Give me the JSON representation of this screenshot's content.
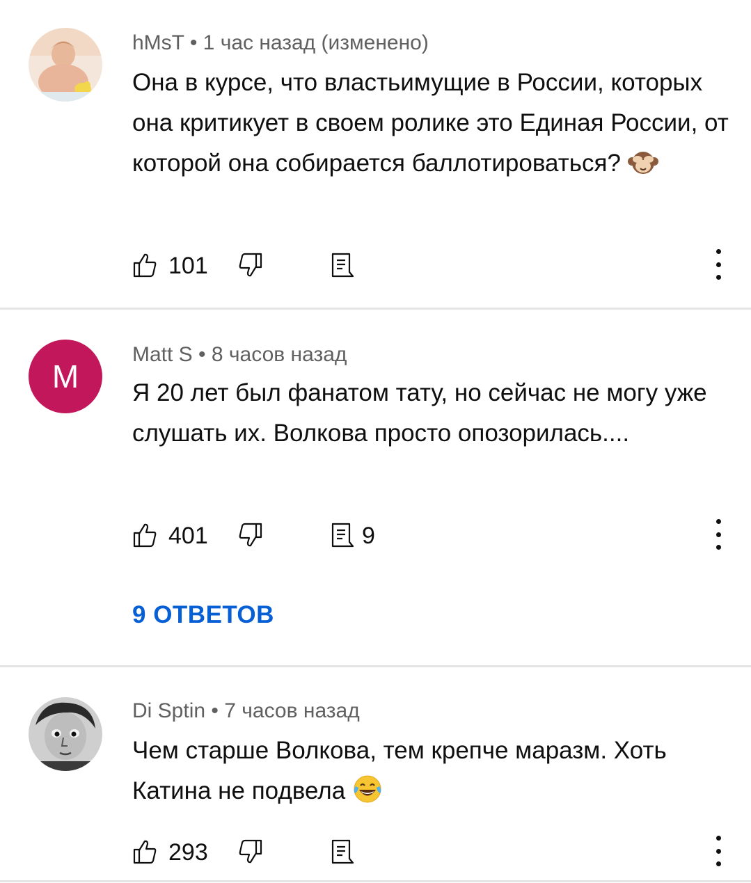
{
  "comments": [
    {
      "author": "hMsT",
      "time": "1 час назад (изменено)",
      "text": "Она в курсе, что властьимущие в России, которых она критикует в  своем ролике это Единая России, от которой она собирается баллотироваться?",
      "emoji": "see-no-evil-monkey",
      "likes": "101",
      "reply_count": ""
    },
    {
      "author": "Matt S",
      "avatar_letter": "M",
      "avatar_color": "#c2185b",
      "time": "8 часов назад",
      "text": "Я 20 лет был фанатом тату, но сейчас не могу уже слушать их. Волкова просто опозорилась....",
      "likes": "401",
      "reply_count": "9",
      "replies_link": "9 ОТВЕТОВ"
    },
    {
      "author": "Di Sptin",
      "time": "7 часов назад",
      "text": "Чем старше Волкова, тем крепче маразм. Хоть Катина не подвела",
      "emoji": "tears-of-joy",
      "likes": "293",
      "reply_count": ""
    }
  ],
  "meta_separator": "•",
  "colors": {
    "link": "#065fd4",
    "meta": "#606060",
    "divider": "#e5e5e5"
  }
}
